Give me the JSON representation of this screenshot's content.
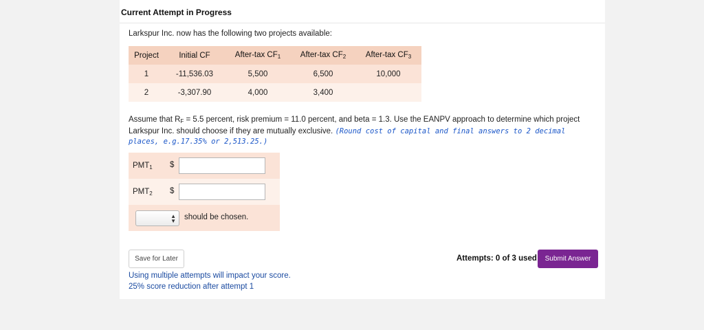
{
  "header": {
    "title": "Current Attempt in Progress"
  },
  "question": {
    "intro": "Larkspur Inc. now has the following two projects available:",
    "assume_prefix": "Assume that R",
    "assume_sub": "F",
    "assume_text": " = 5.5 percent, risk premium = 11.0 percent, and beta = 1.3. Use the EANPV approach to determine which project Larkspur Inc. should choose if they are mutually exclusive. ",
    "note": "(Round cost of capital and final answers to 2 decimal places, e.g.17.35% or 2,513.25.)"
  },
  "table": {
    "headers": [
      {
        "text": "Project",
        "sub": ""
      },
      {
        "text": "Initial CF",
        "sub": ""
      },
      {
        "text": "After-tax CF",
        "sub": "1"
      },
      {
        "text": "After-tax CF",
        "sub": "2"
      },
      {
        "text": "After-tax CF",
        "sub": "3"
      }
    ],
    "rows": [
      [
        "1",
        "-11,536.03",
        "5,500",
        "6,500",
        "10,000"
      ],
      [
        "2",
        "-3,307.90",
        "4,000",
        "3,400",
        ""
      ]
    ]
  },
  "form": {
    "pmt1_label": "PMT",
    "pmt1_sub": "1",
    "pmt2_label": "PMT",
    "pmt2_sub": "2",
    "currency": "$",
    "pmt1_value": "",
    "pmt2_value": "",
    "select_value": "",
    "chosen_text": "should be chosen."
  },
  "footer": {
    "save_label": "Save for Later",
    "warning_line1": "Using multiple attempts will impact your score.",
    "warning_line2": "25% score reduction after attempt 1",
    "attempts_text": "Attempts: 0 of 3 used",
    "submit_label": "Submit Answer"
  },
  "colors": {
    "header_row": "#f5d2bf",
    "row_odd": "#fbe3d7",
    "row_even": "#fdf1ea",
    "submit": "#7a2592",
    "note": "#1a56c8"
  }
}
